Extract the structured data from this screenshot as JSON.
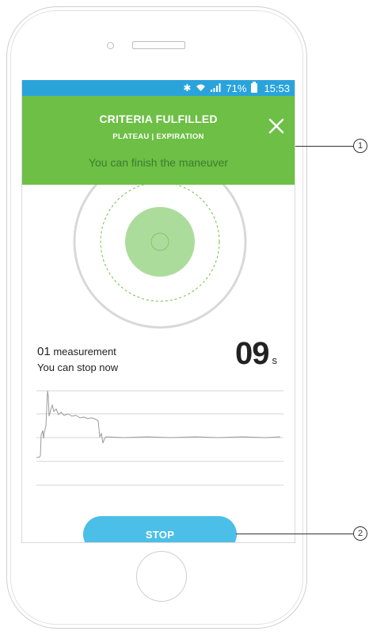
{
  "status_bar": {
    "bluetooth_icon": "bluetooth-icon",
    "wifi_icon": "wifi-icon",
    "signal_icon": "signal-icon",
    "battery_icon": "battery-icon",
    "battery": "71%",
    "time": "15:53"
  },
  "banner": {
    "title": "CRITERIA FULFILLED",
    "subtitle": "PLATEAU | EXPIRATION",
    "message": "You can finish the maneuver",
    "close_icon": "close-icon",
    "color": "#6dbf45"
  },
  "measurement": {
    "count": "01",
    "label": "measurement",
    "status": "You can stop now",
    "timer_value": "09",
    "timer_unit": "s"
  },
  "actions": {
    "stop_label": "STOP",
    "color": "#4bbfe8"
  },
  "callouts": [
    "1",
    "2"
  ],
  "colors": {
    "status_bar": "#2aa3db",
    "target_fill": "#8fd07a",
    "graph_line": "#9a9a9a"
  }
}
